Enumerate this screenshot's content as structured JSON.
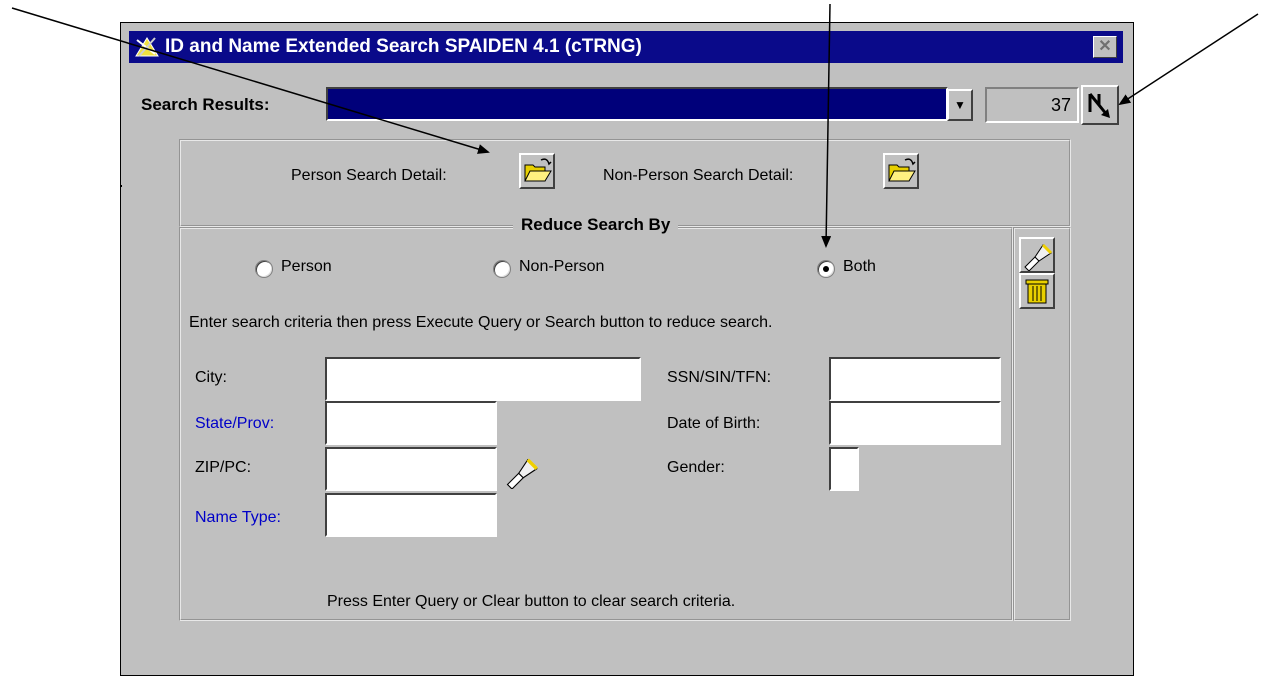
{
  "window": {
    "title": "ID and Name Extended Search  SPAIDEN  4.1  (cTRNG)",
    "close_glyph": "✕"
  },
  "search_results": {
    "label": "Search Results:",
    "count": "37",
    "dropdown_glyph": "▼"
  },
  "detail_row": {
    "person_label": "Person Search Detail:",
    "non_person_label": "Non-Person Search Detail:"
  },
  "reduce": {
    "legend": "Reduce Search By",
    "radios": [
      {
        "label": "Person",
        "selected": false
      },
      {
        "label": "Non-Person",
        "selected": false
      },
      {
        "label": "Both",
        "selected": true
      }
    ],
    "instructions": "Enter search criteria then press Execute Query or Search button to reduce search.",
    "footer": "Press Enter Query or Clear button to clear search criteria."
  },
  "fields": {
    "city": {
      "label": "City:",
      "value": ""
    },
    "state": {
      "label": "State/Prov:",
      "value": ""
    },
    "zip": {
      "label": "ZIP/PC:",
      "value": ""
    },
    "name_type": {
      "label": "Name Type:",
      "value": ""
    },
    "ssn": {
      "label": "SSN/SIN/TFN:",
      "value": ""
    },
    "dob": {
      "label": "Date of Birth:",
      "value": ""
    },
    "gender": {
      "label": "Gender:",
      "value": ""
    }
  },
  "colors": {
    "titlebar": "#0a0a8a",
    "window_bg": "#c0c0c0",
    "lov_label": "#0000c8"
  },
  "icons": [
    "app-icon",
    "close-icon",
    "dropdown-arrow-icon",
    "navigate-icon",
    "open-folder-icon",
    "flashlight-icon",
    "trash-can-icon"
  ]
}
